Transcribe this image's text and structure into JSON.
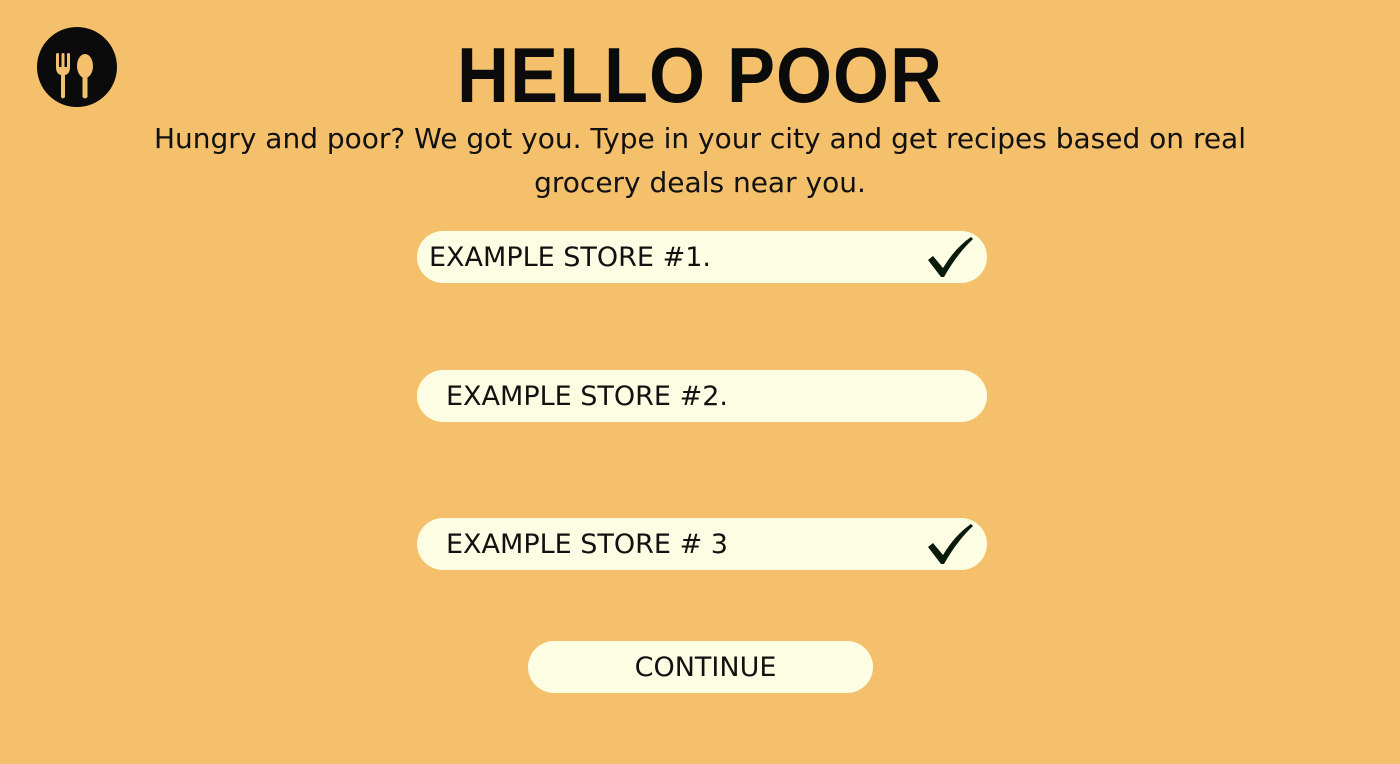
{
  "header": {
    "logo_icon": "fork-spoon-icon",
    "title": "HELLO POOR",
    "subtitle": "Hungry and poor? We got you. Type in your city and get recipes based on real grocery deals near you."
  },
  "stores": [
    {
      "label": "EXAMPLE STORE #1.",
      "selected": true
    },
    {
      "label": "EXAMPLE STORE #2.",
      "selected": false
    },
    {
      "label": "EXAMPLE STORE # 3",
      "selected": true
    }
  ],
  "actions": {
    "continue_label": "CONTINUE"
  },
  "colors": {
    "background": "#f4c06c",
    "pill": "#fdfde4",
    "text": "#111111",
    "check": "#0a1a0a"
  }
}
